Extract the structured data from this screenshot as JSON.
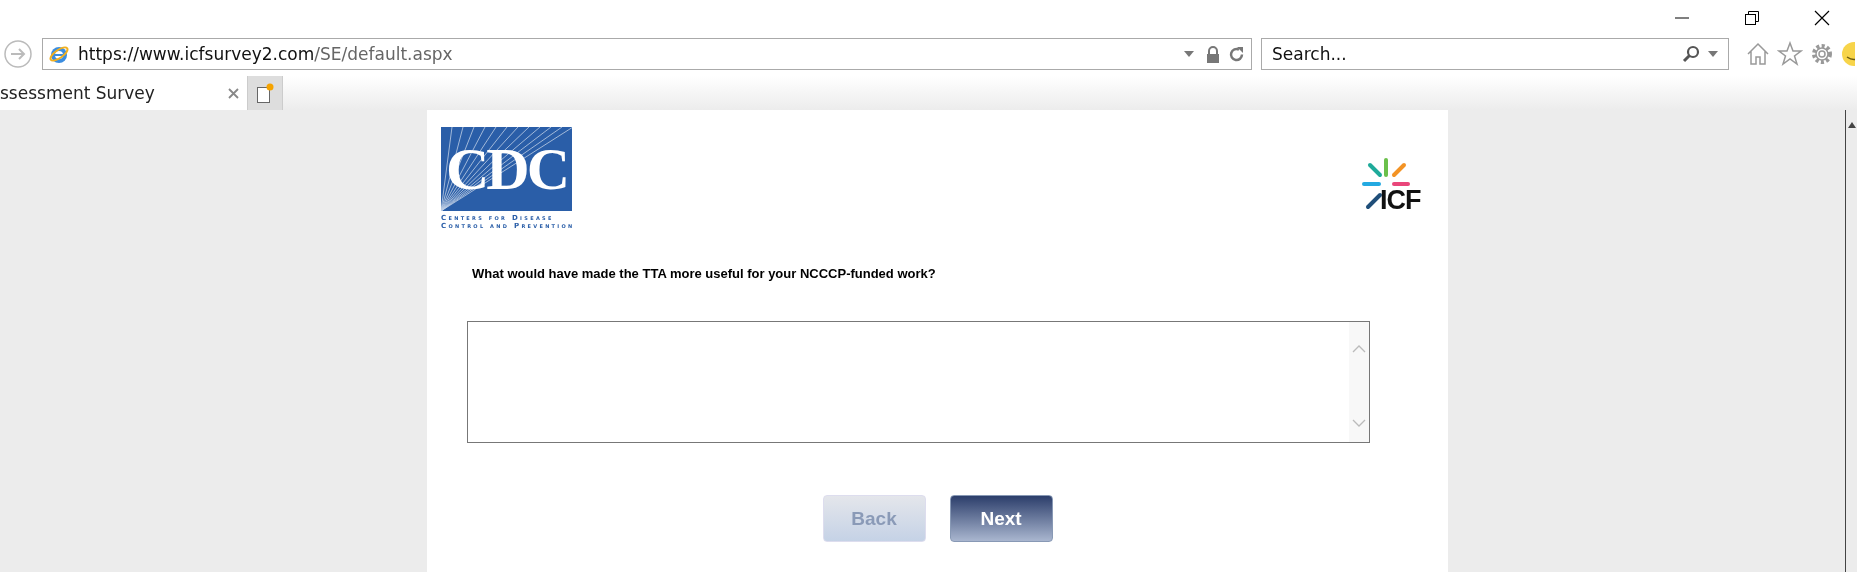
{
  "address_bar": {
    "url_host": "https://www.icfsurvey2.com",
    "url_path": "/SE/default.aspx"
  },
  "search": {
    "placeholder": "Search..."
  },
  "tabs": [
    {
      "label": "ssessment Survey",
      "selected": true
    }
  ],
  "page": {
    "cdc_logo": {
      "mark": "CDC",
      "line_1": "Centers for Disease",
      "line_2": "Control and Prevention"
    },
    "icf_logo": {
      "mark": "ICF"
    },
    "question": "What would have made the TTA more useful for your NCCCP-funded work?",
    "buttons": [
      {
        "label": "Back",
        "disabled": true
      },
      {
        "label": "Next",
        "disabled": false
      }
    ]
  }
}
